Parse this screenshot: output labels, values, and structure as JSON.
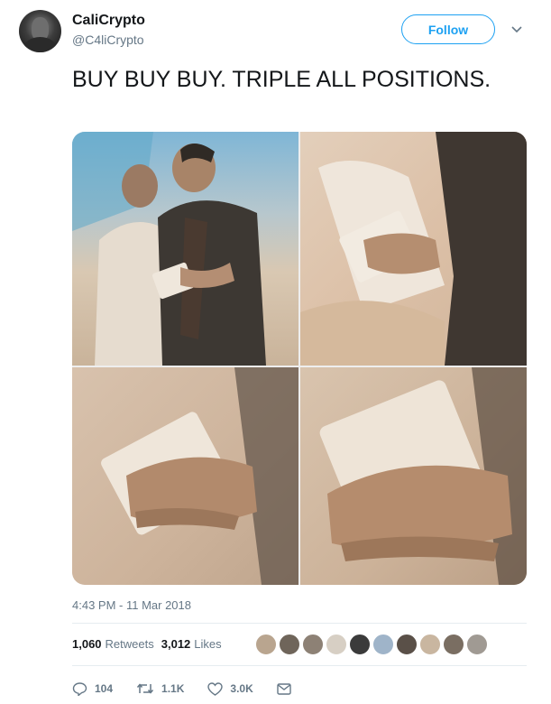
{
  "user": {
    "display_name": "CaliCrypto",
    "handle": "@C4liCrypto",
    "avatar_icon": "user-avatar"
  },
  "follow_label": "Follow",
  "tweet": {
    "text": "BUY BUY BUY. TRIPLE ALL POSITIONS.",
    "timestamp": "4:43 PM - 11 Mar 2018"
  },
  "stats": {
    "retweets_count": "1,060",
    "retweets_label": "Retweets",
    "likes_count": "3,012",
    "likes_label": "Likes"
  },
  "liker_colors": [
    "#b9a58f",
    "#6f655a",
    "#8d8175",
    "#d7cfc4",
    "#3b3b3b",
    "#9fb4c9",
    "#5a5048",
    "#c9b6a0",
    "#7a6e62",
    "#a09a93"
  ],
  "actions": {
    "reply": "104",
    "retweet": "1.1K",
    "like": "3.0K"
  },
  "colors": {
    "accent": "#1da1f2",
    "secondary_text": "#657786"
  }
}
